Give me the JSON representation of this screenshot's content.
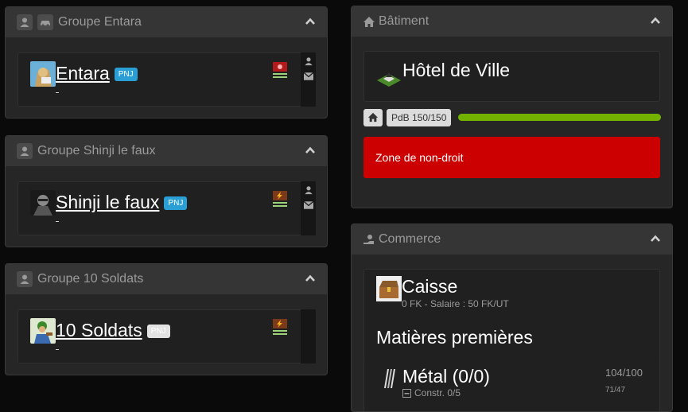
{
  "groups": [
    {
      "title": "Groupe Entara",
      "name": "Entara",
      "tag": "PNJ",
      "tag_color": "#2a9fd6",
      "has_vehicle_icon": true,
      "badge": "red-emblem-icon"
    },
    {
      "title": "Groupe Shinji le faux",
      "name": "Shinji le faux",
      "tag": "PNJ",
      "tag_color": "#2a9fd6",
      "has_vehicle_icon": false,
      "badge": "lightning-emblem-icon"
    },
    {
      "title": "Groupe 10 Soldats",
      "name": "10 Soldats",
      "tag": "PNJ",
      "tag_color": "#e3e3e3",
      "has_vehicle_icon": false,
      "badge": "lightning-emblem-icon"
    }
  ],
  "building": {
    "header": "Bâtiment",
    "name": "Hôtel de Ville",
    "pdb_label": "PdB 150/150",
    "pdb_ratio": 1.0,
    "bar_color": "#73b300",
    "zone_text": "Zone de non-droit",
    "zone_color": "#cc0000"
  },
  "commerce": {
    "header": "Commerce",
    "caisse_title": "Caisse",
    "caisse_sub": "0 FK - Salaire : 50 FK/UT",
    "section_title": "Matières premières",
    "metal_name": "Métal (0/0)",
    "metal_constr": "Constr. 0/5",
    "metal_stock": "104/100",
    "metal_small": "71/47"
  }
}
